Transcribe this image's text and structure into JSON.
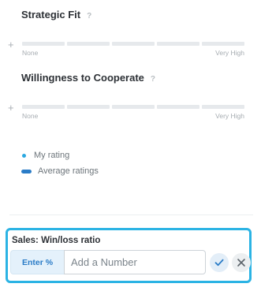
{
  "ratings": [
    {
      "title": "Strategic Fit",
      "help": "?",
      "min_label": "None",
      "max_label": "Very High",
      "segments": 5
    },
    {
      "title": "Willingness to Cooperate",
      "help": "?",
      "min_label": "None",
      "max_label": "Very High",
      "segments": 5
    }
  ],
  "legend": {
    "my_rating": "My rating",
    "average_ratings": "Average ratings"
  },
  "field": {
    "label": "Sales: Win/loss ratio",
    "prefix": "Enter %",
    "placeholder": "Add a Number",
    "value": ""
  },
  "colors": {
    "accent": "#2bb3e4",
    "my_rating_dot": "#2ba8e0",
    "average_pill": "#2a7cc7",
    "track": "#e6e9ec"
  },
  "icons": {
    "add": "plus-icon",
    "help": "help-icon",
    "confirm": "check-icon",
    "cancel": "close-icon"
  }
}
